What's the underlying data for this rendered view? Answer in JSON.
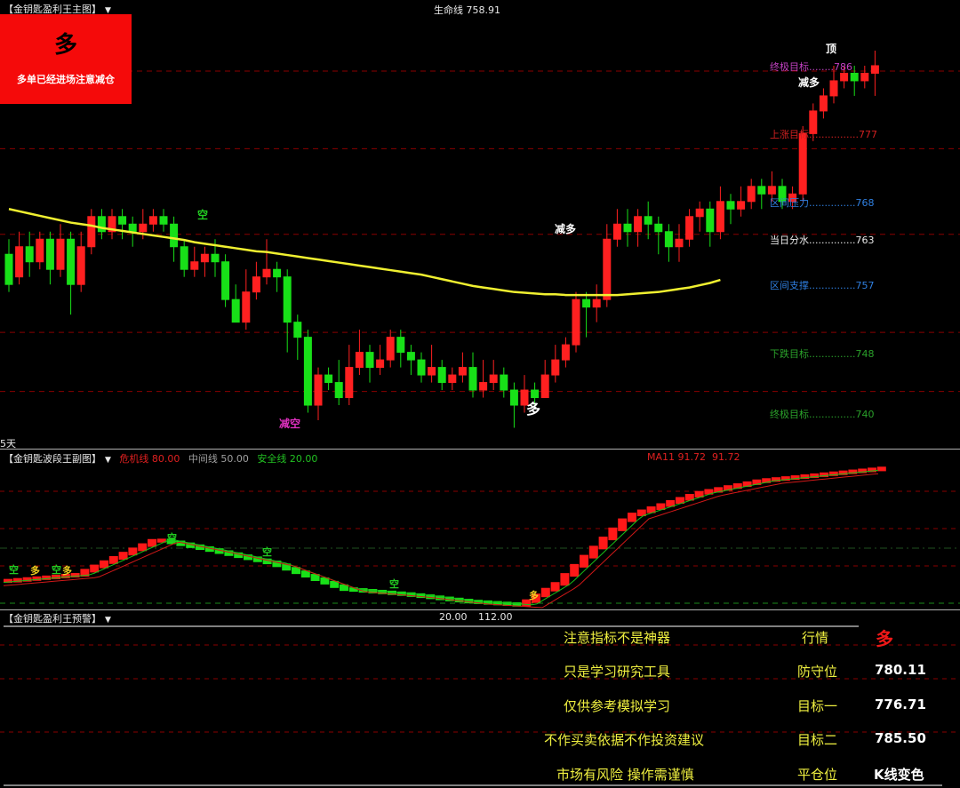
{
  "main": {
    "title": "【金钥匙盈利王主图】",
    "life_line": "生命线 758.91",
    "signal": {
      "big": "多",
      "text": "多单已经进场注意减仓"
    },
    "period": "5天",
    "levels": [
      {
        "name": "终极目标",
        "dots": "........",
        "value": "786",
        "price": 786,
        "color": "#c040c0"
      },
      {
        "name": "上涨目标",
        "dots": "................",
        "value": "777",
        "price": 777,
        "color": "#d02020"
      },
      {
        "name": "区间压力",
        "dots": "...............",
        "value": "768",
        "price": 768,
        "color": "#2f7fe0"
      },
      {
        "name": "当日分水",
        "dots": "...............",
        "value": "763",
        "price": 763,
        "color": "#e8e8e8"
      },
      {
        "name": "区间支撑",
        "dots": "...............",
        "value": "757",
        "price": 757,
        "color": "#2f7fe0"
      },
      {
        "name": "下跌目标",
        "dots": "...............",
        "value": "748",
        "price": 748,
        "color": "#2aa02a"
      },
      {
        "name": "终极目标",
        "dots": "...............",
        "value": "740",
        "price": 740,
        "color": "#2aa02a"
      }
    ],
    "annotations": [
      {
        "text": "顶",
        "color": "#ffffff",
        "bar": 69
      },
      {
        "text": "减多",
        "color": "#ffffff",
        "bar": 68
      },
      {
        "text": "减多",
        "color": "#ffffff",
        "bar": 46
      },
      {
        "text": "空",
        "color": "#22cc22",
        "bar": 17
      },
      {
        "text": "减空",
        "color": "#e030c0",
        "bar": 24
      },
      {
        "text": "多",
        "color": "#ffffff",
        "bar": 45
      }
    ],
    "colors": {
      "up": "#ff2020",
      "down": "#18e018",
      "ma": "#f0f030"
    }
  },
  "sub": {
    "title": "【金钥匙波段王副图】",
    "danger": "危机线 80.00",
    "middle": "中间线 50.00",
    "safe": "安全线 20.00",
    "ma": "MA11 91.72",
    "ma_val": "91.72",
    "labels": [
      {
        "text": "空",
        "color": "#22cc22"
      },
      {
        "text": "多",
        "color": "#f0d020"
      },
      {
        "text": "空",
        "color": "#22cc22"
      },
      {
        "text": "多",
        "color": "#f0d020"
      },
      {
        "text": "空",
        "color": "#22cc22"
      },
      {
        "text": "空",
        "color": "#22cc22"
      },
      {
        "text": "空",
        "color": "#22cc22"
      },
      {
        "text": "多",
        "color": "#f0d020"
      }
    ]
  },
  "alert": {
    "title": "【金钥匙盈利王预警】",
    "val1": "20.00",
    "val2": "112.00",
    "rows": [
      {
        "left": "注意指标不是神器",
        "mid": "行情",
        "right": "多"
      },
      {
        "left": "只是学习研究工具",
        "mid": "防守位",
        "right": "780.11"
      },
      {
        "left": "仅供参考模拟学习",
        "mid": "目标一",
        "right": "776.71"
      },
      {
        "left": "不作买卖依据不作投资建议",
        "mid": "目标二",
        "right": "785.50"
      },
      {
        "left": "市场有风险 操作需谨慎",
        "mid": "平仓位",
        "right": "K线变色"
      }
    ]
  },
  "chart_data": {
    "type": "candlestick",
    "title": "",
    "ylim": [
      737,
      790
    ],
    "candles": [
      [
        761,
        757,
        763,
        756
      ],
      [
        758,
        762,
        764,
        757
      ],
      [
        762,
        760,
        764,
        758
      ],
      [
        760,
        763,
        764,
        759
      ],
      [
        763,
        759,
        764,
        757
      ],
      [
        759,
        763,
        765,
        758
      ],
      [
        763,
        757,
        764,
        753
      ],
      [
        757,
        762,
        764,
        756
      ],
      [
        762,
        766,
        767,
        761
      ],
      [
        766,
        764,
        767,
        763
      ],
      [
        764,
        766,
        767,
        763
      ],
      [
        766,
        765,
        767,
        763
      ],
      [
        765,
        764,
        766,
        762
      ],
      [
        764,
        765,
        767,
        763
      ],
      [
        765,
        766,
        767,
        764
      ],
      [
        766,
        765,
        767,
        764
      ],
      [
        765,
        762,
        766,
        760
      ],
      [
        762,
        759,
        763,
        758
      ],
      [
        759,
        760,
        762,
        758
      ],
      [
        760,
        761,
        762,
        758
      ],
      [
        761,
        760,
        763,
        758
      ],
      [
        760,
        755,
        761,
        754
      ],
      [
        755,
        752,
        757,
        752
      ],
      [
        752,
        756,
        759,
        751
      ],
      [
        756,
        758,
        760,
        755
      ],
      [
        758,
        759,
        763,
        757
      ],
      [
        759,
        758,
        760,
        756
      ],
      [
        758,
        752,
        759,
        748
      ],
      [
        752,
        750,
        753,
        747
      ],
      [
        750,
        741,
        751,
        740
      ],
      [
        741,
        745,
        746,
        739
      ],
      [
        745,
        744,
        746,
        743
      ],
      [
        744,
        742,
        747,
        741
      ],
      [
        742,
        746,
        749,
        741
      ],
      [
        746,
        748,
        751,
        745
      ],
      [
        748,
        746,
        749,
        744
      ],
      [
        746,
        747,
        749,
        745
      ],
      [
        747,
        750,
        751,
        746
      ],
      [
        750,
        748,
        751,
        746
      ],
      [
        748,
        747,
        749,
        745
      ],
      [
        747,
        745,
        748,
        744
      ],
      [
        745,
        746,
        749,
        744
      ],
      [
        746,
        744,
        747,
        743
      ],
      [
        744,
        745,
        746,
        743
      ],
      [
        745,
        746,
        748,
        744
      ],
      [
        746,
        743,
        748,
        742
      ],
      [
        743,
        744,
        747,
        742
      ],
      [
        744,
        745,
        747,
        743
      ],
      [
        745,
        743,
        746,
        742
      ],
      [
        743,
        741,
        744,
        738
      ],
      [
        741,
        743,
        745,
        740
      ],
      [
        743,
        742,
        744,
        741
      ],
      [
        742,
        745,
        747,
        742
      ],
      [
        745,
        747,
        749,
        744
      ],
      [
        747,
        749,
        750,
        746
      ],
      [
        749,
        755,
        756,
        748
      ],
      [
        755,
        754,
        756,
        750
      ],
      [
        754,
        755,
        757,
        752
      ],
      [
        755,
        763,
        765,
        754
      ],
      [
        763,
        765,
        767,
        762
      ],
      [
        765,
        764,
        767,
        762
      ],
      [
        764,
        766,
        767,
        762
      ],
      [
        766,
        765,
        768,
        763
      ],
      [
        765,
        764,
        766,
        761
      ],
      [
        764,
        762,
        765,
        760
      ],
      [
        762,
        763,
        765,
        760
      ],
      [
        763,
        766,
        767,
        762
      ],
      [
        766,
        767,
        768,
        764
      ],
      [
        767,
        764,
        768,
        762
      ],
      [
        764,
        768,
        770,
        763
      ],
      [
        768,
        767,
        769,
        765
      ],
      [
        767,
        768,
        770,
        766
      ],
      [
        768,
        770,
        771,
        767
      ],
      [
        770,
        769,
        771,
        767
      ],
      [
        769,
        770,
        772,
        768
      ],
      [
        770,
        768,
        771,
        767
      ],
      [
        768,
        769,
        770,
        767
      ],
      [
        769,
        777,
        778,
        768
      ],
      [
        777,
        780,
        781,
        776
      ],
      [
        780,
        782,
        783,
        779
      ],
      [
        782,
        784,
        786,
        781
      ],
      [
        784,
        785,
        786,
        783
      ],
      [
        785,
        784,
        786,
        782
      ],
      [
        784,
        785,
        786,
        783
      ],
      [
        785,
        786,
        788,
        782
      ]
    ],
    "ma": [
      767,
      766.7,
      766.4,
      766.1,
      765.8,
      765.5,
      765.2,
      765,
      764.8,
      764.5,
      764.3,
      764.1,
      763.9,
      763.7,
      763.5,
      763.3,
      763.1,
      762.9,
      762.6,
      762.4,
      762.2,
      762,
      761.8,
      761.6,
      761.4,
      761.3,
      761.1,
      760.9,
      760.7,
      760.5,
      760.3,
      760.1,
      759.9,
      759.7,
      759.5,
      759.3,
      759.1,
      758.9,
      758.7,
      758.5,
      758.3,
      758,
      757.7,
      757.4,
      757.1,
      756.8,
      756.6,
      756.4,
      756.2,
      756,
      755.9,
      755.8,
      755.7,
      755.7,
      755.6,
      755.6,
      755.6,
      755.6,
      755.6,
      755.6,
      755.7,
      755.8,
      755.9,
      756,
      756.2,
      756.4,
      756.6,
      756.9,
      757.2,
      757.6
    ]
  }
}
